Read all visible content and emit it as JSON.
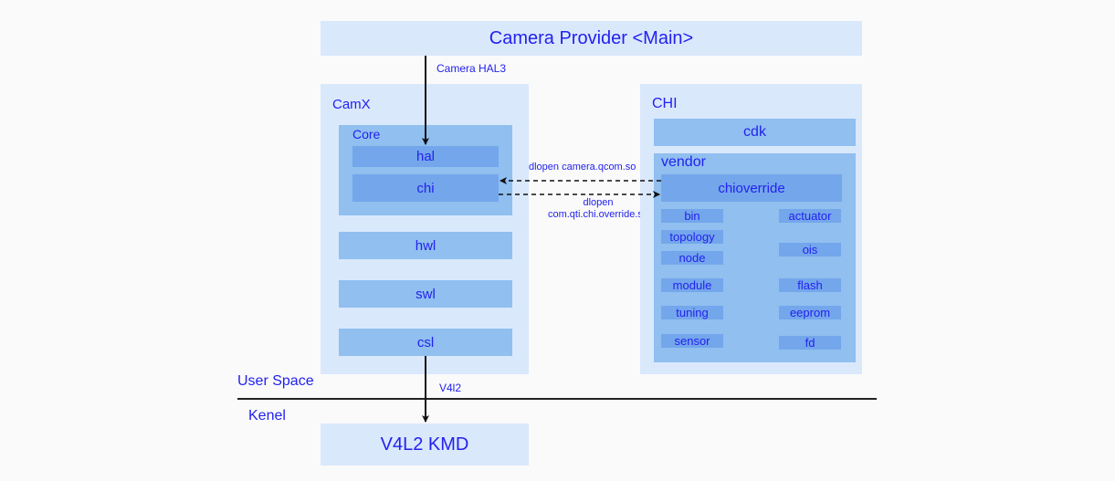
{
  "provider": {
    "title": "Camera Provider <Main>"
  },
  "edges": {
    "hal3": "Camera HAL3",
    "dlopen_camera": "dlopen camera.qcom.so",
    "dlopen_override_line1": "dlopen",
    "dlopen_override_line2": "com.qti.chi.override.so",
    "v4l2": "V4l2"
  },
  "camx": {
    "title": "CamX",
    "core": {
      "title": "Core",
      "items": [
        "hal",
        "chi"
      ]
    },
    "layers": [
      "hwl",
      "swl",
      "csl"
    ]
  },
  "chi": {
    "title": "CHI",
    "cdk": "cdk",
    "vendor": {
      "title": "vendor",
      "override": "chioverride",
      "left_items": [
        "bin",
        "topology",
        "node",
        "module",
        "tuning",
        "sensor"
      ],
      "right_items": [
        "actuator",
        "ois",
        "flash",
        "eeprom",
        "fd"
      ]
    }
  },
  "space": {
    "user": "User Space",
    "kernel": "Kenel"
  },
  "kmd": {
    "title": "V4L2 KMD"
  }
}
